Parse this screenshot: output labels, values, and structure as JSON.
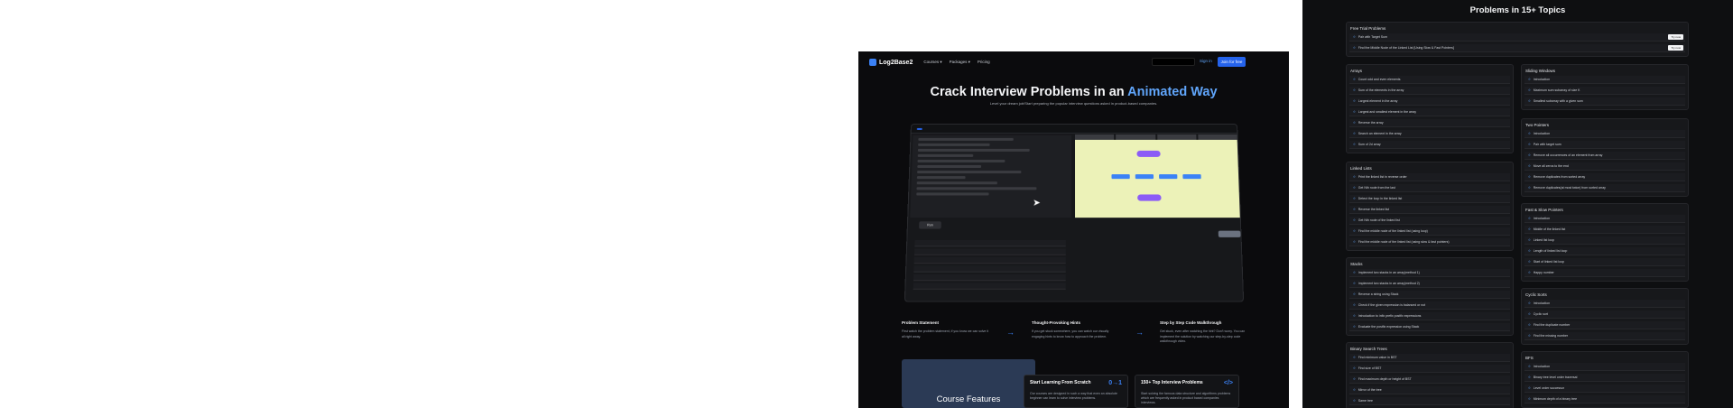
{
  "landing": {
    "logo": "Log2Base2",
    "nav": [
      "Courses ▾",
      "Packages ▾",
      "Pricing"
    ],
    "signin": "Sign in",
    "join": "Join for free",
    "hero_main": "Crack Interview Problems in an ",
    "hero_accent": "Animated Way",
    "subtitle": "Level your dream job!Start preparing the popular interview questions asked in product-based companies.",
    "demo": {
      "run": "Run",
      "next": "Next"
    },
    "features": [
      {
        "title": "Problem Statement",
        "desc": "First watch the problem statement, if you know we can solve it all right away."
      },
      {
        "title": "Thought-Provoking Hints",
        "desc": "If you get stuck somewhere, you can watch our visually engaging hints to know how to approach the problem."
      },
      {
        "title": "Step by Step Code Walkthrough",
        "desc": "Get stuck, even after watching the hint? Don't worry. You can implement the solution by watching our step-by-step code walkthrough video."
      }
    ],
    "course_features": "Course Features",
    "cards": [
      {
        "title": "Start Learning From Scratch",
        "icon": "0→1",
        "desc": "Our courses are designed in such a way that even an absolute beginner can learn to solve interview problems."
      },
      {
        "title": "150+ Top Interview Problems",
        "icon": "</>",
        "desc": "Start solving the famous data structure and algorithms problems which are frequently asked in product based companies interviews."
      }
    ]
  },
  "problems": {
    "title": "Problems in 15+ Topics",
    "free_trial": {
      "title": "Free Trial Problems",
      "try_label": "Try now",
      "items": [
        "Pair with Target Sum",
        "Find the Middle Node of the Linked List [Using Slow & Fast Pointers]"
      ]
    },
    "left_sections": [
      {
        "title": "Arrays",
        "items": [
          "Count odd and even elements",
          "Sum of the elements in the array",
          "Largest element in the array",
          "Largest and smallest element in the array",
          "Reverse the array",
          "Search an element in the array",
          "Sum of 2d array"
        ]
      },
      {
        "title": "Linked Lists",
        "items": [
          "Print the linked list in reverse order",
          "Get Nth node from the last",
          "Detect the loop in the linked list",
          "Reverse the linked list",
          "Get Nth node of the linked list",
          "Find the middle node of the linked list (using loop)",
          "Find the middle node of the linked list (using slow & fast pointers)"
        ]
      },
      {
        "title": "Stacks",
        "items": [
          "Implement two stacks in an array(method 1)",
          "Implement two stacks in an array(method 2)",
          "Reverse a string using Stack",
          "Check if the given expression is balanced or not",
          "Introduction to infix prefix postfix expressions",
          "Evaluate the postfix expression using Stack"
        ]
      },
      {
        "title": "Binary Search Trees",
        "items": [
          "Find minimum value in BST",
          "Find size of BST",
          "Find maximum depth or height of BST",
          "Mirror of the tree",
          "Same tree"
        ]
      }
    ],
    "right_sections": [
      {
        "title": "Sliding Windows",
        "items": [
          "Introduction",
          "Maximum sum subarray of size K",
          "Smallest subarray with a given sum"
        ]
      },
      {
        "title": "Two Pointers",
        "items": [
          "Introduction",
          "Pair with target sum",
          "Remove all occurrences of an element from array",
          "Move all zeros to the end",
          "Remove duplicates from sorted array",
          "Remove duplicates(at most twice) from sorted array"
        ]
      },
      {
        "title": "Fast & Slow Pointers",
        "items": [
          "Introduction",
          "Middle of the linked list",
          "Linked list loop",
          "Length of linked list loop",
          "Start of linked list loop",
          "Happy number"
        ]
      },
      {
        "title": "Cyclic Sorts",
        "items": [
          "Introduction",
          "Cyclic sort",
          "Find the duplicate number",
          "Find the missing number"
        ]
      },
      {
        "title": "BFS",
        "items": [
          "Introduction",
          "Binary tree level order traversal",
          "Level order successor",
          "Minimum depth of a binary tree"
        ]
      }
    ]
  },
  "colors": {
    "accent": "#3b82f6",
    "background": "#0e0f11",
    "panel": "#17181b"
  }
}
